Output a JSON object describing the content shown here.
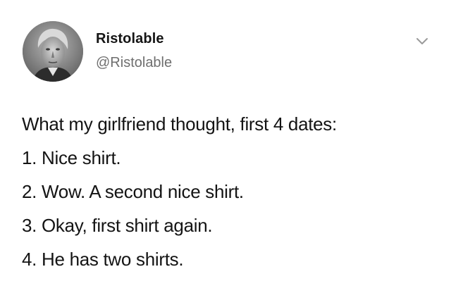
{
  "tweet": {
    "author_name": "Ristolable",
    "author_handle": "@Ristolable",
    "lines": [
      "What my girlfriend thought, first 4 dates:",
      "1. Nice shirt.",
      "2. Wow. A second nice shirt.",
      "3. Okay, first shirt again.",
      "4. He has two shirts."
    ]
  },
  "icons": {
    "avatar": "avatar-portrait",
    "menu": "chevron-down-icon"
  },
  "colors": {
    "background": "#ffffff",
    "text": "#141414",
    "handle": "#6f6f6f",
    "chevron": "#9a9a9a"
  }
}
